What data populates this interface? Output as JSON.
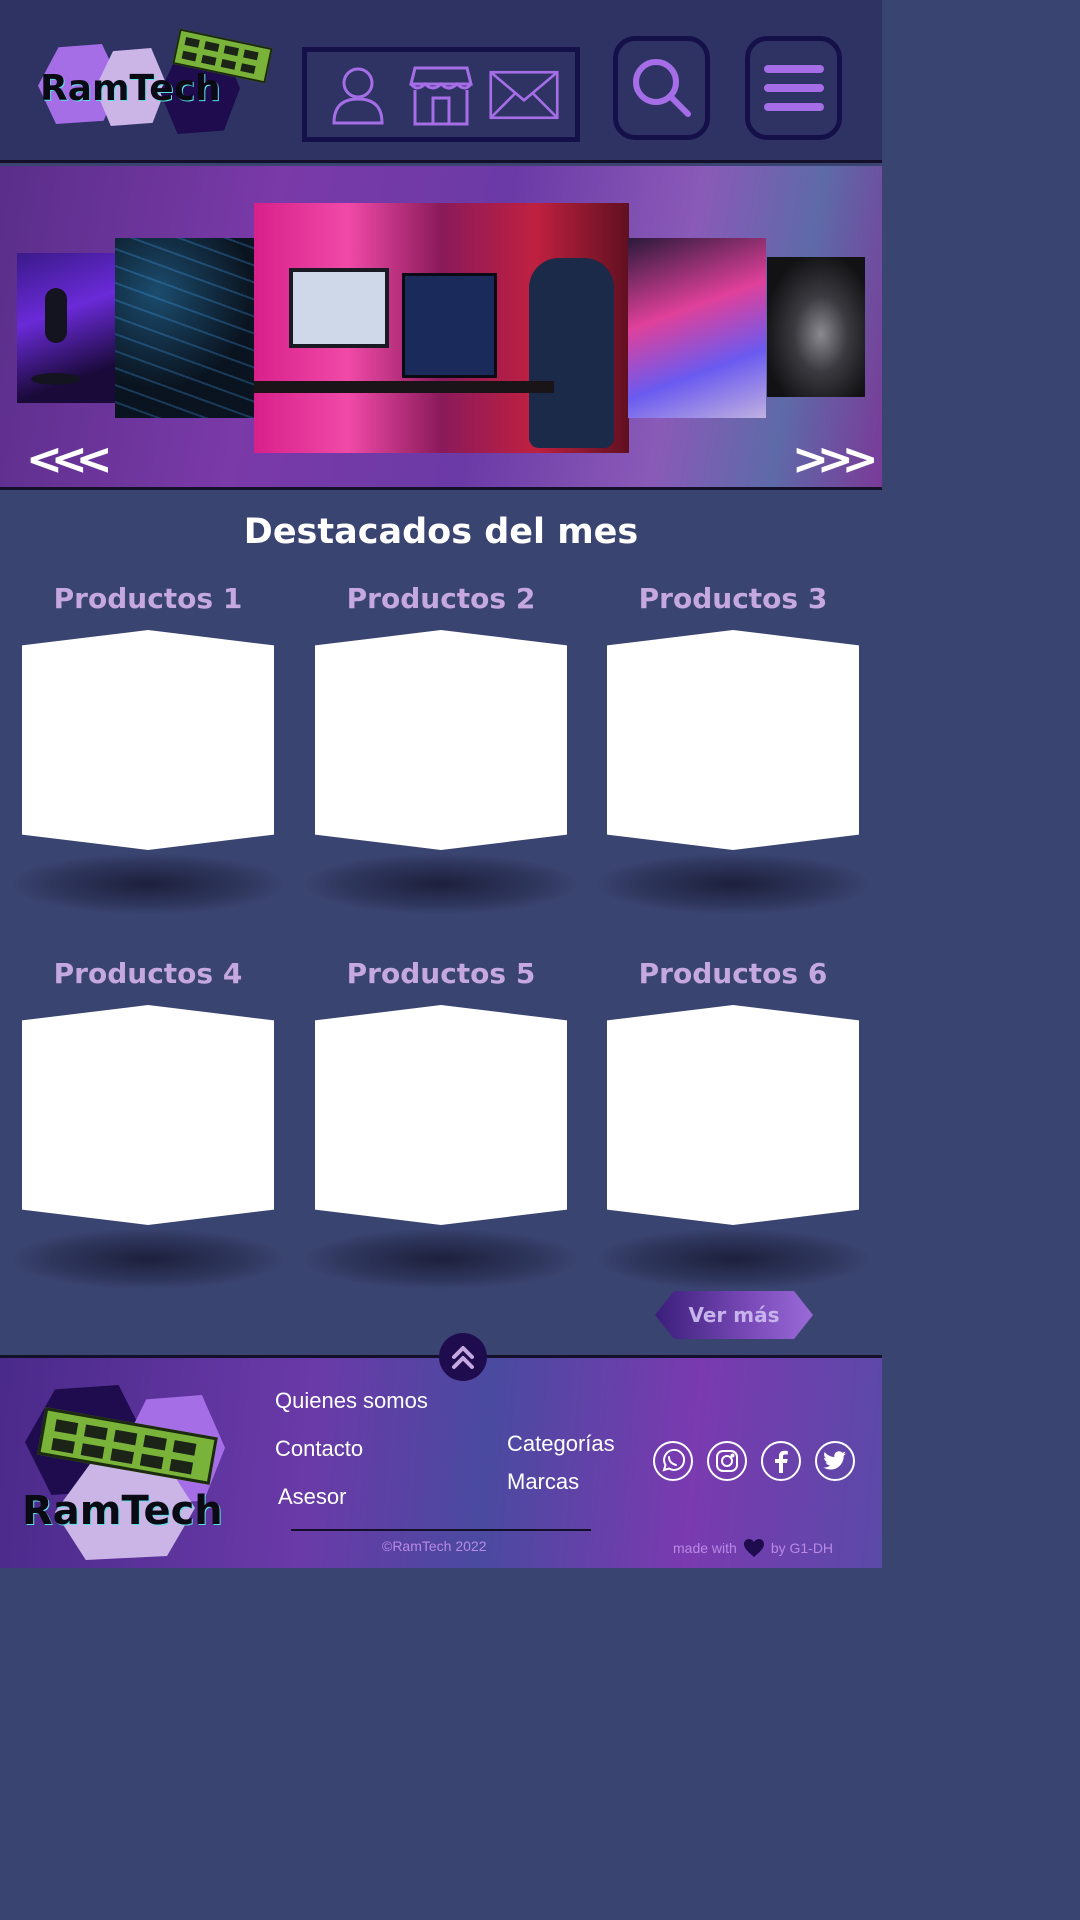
{
  "header": {
    "brand": "RamTech",
    "nav_icons": [
      "user-icon",
      "store-icon",
      "mail-icon"
    ],
    "search_icon": "search-icon",
    "menu_icon": "hamburger-menu-icon"
  },
  "carousel": {
    "prev_label": "<<<",
    "next_label": ">>>",
    "slides": [
      "microphone",
      "keyboard",
      "gaming-desk",
      "laptop",
      "mouse"
    ]
  },
  "featured": {
    "title": "Destacados del mes",
    "products": [
      {
        "title": "Productos 1"
      },
      {
        "title": "Productos 2"
      },
      {
        "title": "Productos 3"
      },
      {
        "title": "Productos 4"
      },
      {
        "title": "Productos 5"
      },
      {
        "title": "Productos 6"
      }
    ],
    "more_label": "Ver más"
  },
  "footer": {
    "brand": "RamTech",
    "links_left": [
      "Quienes somos",
      "Contacto",
      "Asesor"
    ],
    "links_right": [
      "Categorías",
      "Marcas"
    ],
    "social": [
      "whatsapp-icon",
      "instagram-icon",
      "facebook-icon",
      "twitter-icon"
    ],
    "copyright": "©RamTech 2022",
    "made_with_pre": "made with",
    "made_with_post": "by G1-DH"
  },
  "colors": {
    "background": "#3a4470",
    "header_bg": "#2e3364",
    "accent_purple": "#a56ee6",
    "product_title": "#c6a8e0"
  }
}
